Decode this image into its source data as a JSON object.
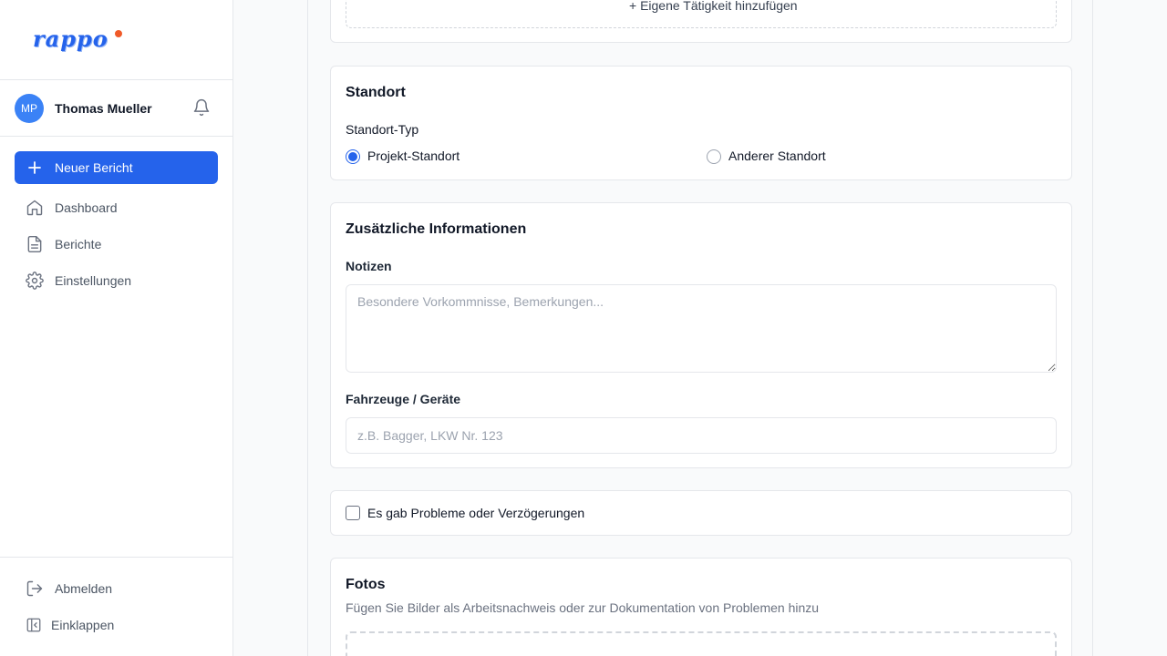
{
  "brand": {
    "name": "rappo",
    "accent": "#2563eb",
    "dot_color": "#f05a28"
  },
  "user": {
    "initials": "MP",
    "name": "Thomas Mueller"
  },
  "sidebar": {
    "new_report_label": "Neuer Bericht",
    "items": [
      {
        "label": "Dashboard",
        "icon": "home-icon"
      },
      {
        "label": "Berichte",
        "icon": "document-icon"
      },
      {
        "label": "Einstellungen",
        "icon": "gear-icon"
      }
    ],
    "bottom": [
      {
        "label": "Abmelden",
        "icon": "logout-icon"
      },
      {
        "label": "Einklappen",
        "icon": "collapse-icon"
      }
    ]
  },
  "form": {
    "activity": {
      "add_custom_label": "+ Eigene Tätigkeit hinzufügen"
    },
    "location": {
      "title": "Standort",
      "type_label": "Standort-Typ",
      "options": [
        {
          "label": "Projekt-Standort",
          "selected": true
        },
        {
          "label": "Anderer Standort",
          "selected": false
        }
      ]
    },
    "additional": {
      "title": "Zusätzliche Informationen",
      "notes_label": "Notizen",
      "notes_placeholder": "Besondere Vorkommnisse, Bemerkungen...",
      "vehicles_label": "Fahrzeuge / Geräte",
      "vehicles_placeholder": "z.B. Bagger, LKW Nr. 123"
    },
    "problems": {
      "label": "Es gab Probleme oder Verzögerungen",
      "checked": false
    },
    "photos": {
      "title": "Fotos",
      "description": "Fügen Sie Bilder als Arbeitsnachweis oder zur Dokumentation von Problemen hinzu"
    }
  }
}
